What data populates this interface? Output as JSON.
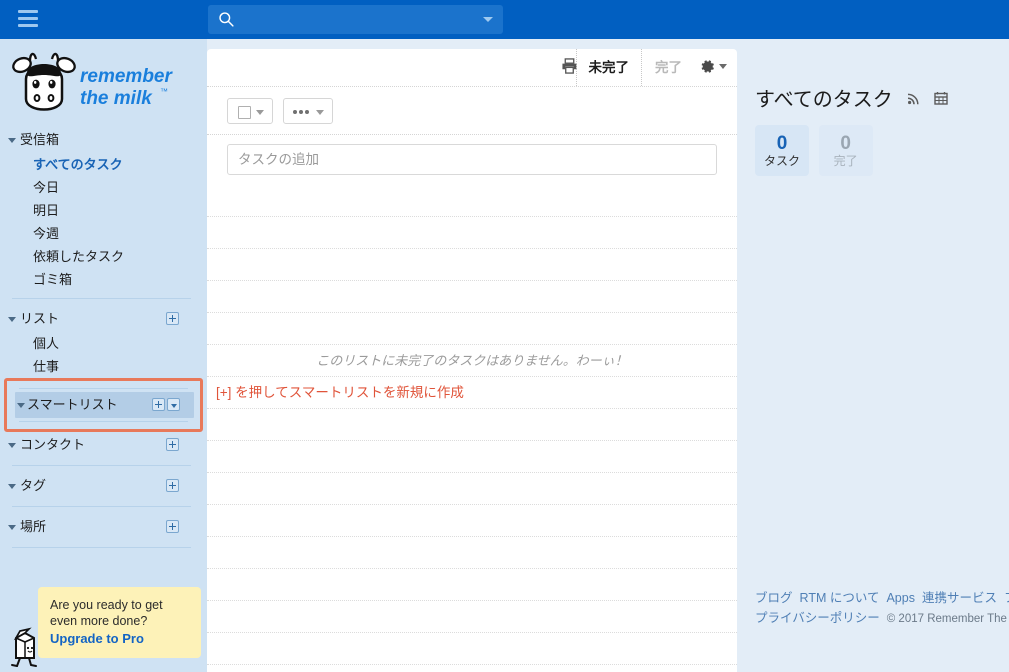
{
  "header": {
    "menu_icon": "hamburger-menu-icon",
    "search_icon": "search-icon",
    "search_placeholder": "",
    "search_value": "",
    "dropdown_icon": "chevron-down-icon"
  },
  "sidebar": {
    "logo_text_line1": "remember",
    "logo_text_line2": "the milk",
    "groups": [
      {
        "label": "受信箱",
        "items": [
          {
            "label": "すべてのタスク",
            "active": true
          },
          {
            "label": "今日",
            "active": false
          },
          {
            "label": "明日",
            "active": false
          },
          {
            "label": "今週",
            "active": false
          },
          {
            "label": "依頼したタスク",
            "active": false
          },
          {
            "label": "ゴミ箱",
            "active": false
          }
        ]
      },
      {
        "label": "リスト",
        "items": [
          {
            "label": "個人",
            "active": false
          },
          {
            "label": "仕事",
            "active": false
          }
        ]
      },
      {
        "label": "スマートリスト",
        "items": []
      },
      {
        "label": "コンタクト",
        "items": []
      },
      {
        "label": "タグ",
        "items": []
      },
      {
        "label": "場所",
        "items": []
      }
    ],
    "promo": {
      "line1": "Are you ready to get",
      "line2": "even more done?",
      "link": "Upgrade to Pro"
    }
  },
  "main": {
    "print_icon": "printer-icon",
    "tab_incomplete": "未完了",
    "tab_complete": "完了",
    "gear_icon": "gear-icon",
    "filter_checkbox_icon": "checkbox-icon",
    "filter_more_icon": "ellipsis-icon",
    "add_task_placeholder": "タスクの追加",
    "add_task_value": "",
    "empty_message": "このリストに未完了のタスクはありません。わーぃ！",
    "hint_message": "[+] を押してスマートリストを新規に作成"
  },
  "right": {
    "title": "すべてのタスク",
    "rss_icon": "rss-icon",
    "calendar_icon": "calendar-icon",
    "stats": [
      {
        "value": "0",
        "label": "タスク",
        "muted": false
      },
      {
        "value": "0",
        "label": "完了",
        "muted": true
      }
    ],
    "footer_links_line1": [
      "ブログ",
      "RTM について",
      "Apps",
      "連携サービス",
      "フ"
    ],
    "footer_links_line2": [
      "プライバシーポリシー"
    ],
    "copyright": "© 2017 Remember The"
  },
  "colors": {
    "header_blue": "#015fc1",
    "sidebar_blue": "#cfe2f3",
    "accent_blue": "#1863b5",
    "highlight_orange": "#e8795a",
    "hint_red": "#e0543a",
    "promo_yellow": "#fdf2b8"
  }
}
